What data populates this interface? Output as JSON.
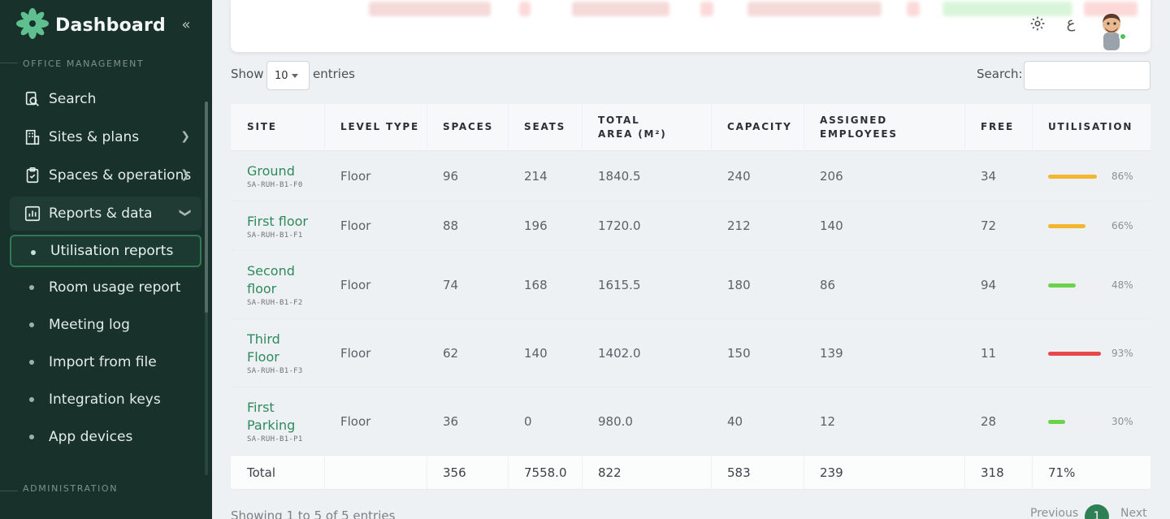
{
  "brand": {
    "title": "Dashboard",
    "collapse_icon": "double-chevron-left-icon"
  },
  "sidebar": {
    "section_office": "OFFICE MANAGEMENT",
    "section_admin": "ADMINISTRATION",
    "items": [
      {
        "label": "Search",
        "icon": "search-icon"
      },
      {
        "label": "Sites & plans",
        "icon": "building-icon"
      },
      {
        "label": "Spaces & operations",
        "icon": "clipboard-check-icon"
      },
      {
        "label": "Reports & data",
        "icon": "chart-icon"
      }
    ],
    "sub_items": [
      {
        "label": "Utilisation reports"
      },
      {
        "label": "Room usage report"
      },
      {
        "label": "Meeting log"
      },
      {
        "label": "Import from file"
      },
      {
        "label": "Integration keys"
      },
      {
        "label": "App devices"
      }
    ]
  },
  "topbar": {
    "settings_icon": "gear-icon",
    "language_glyph": "ع",
    "avatar": "user-avatar"
  },
  "controls": {
    "show_label": "Show",
    "page_length": "10",
    "entries_label": "entries",
    "search_label": "Search:",
    "search_value": ""
  },
  "table": {
    "headers": [
      "SITE",
      "LEVEL TYPE",
      "SPACES",
      "SEATS",
      "TOTAL AREA (M²)",
      "CAPACITY",
      "ASSIGNED EMPLOYEES",
      "FREE",
      "UTILISATION"
    ],
    "rows": [
      {
        "site_lines": [
          "Ground"
        ],
        "code": "SA-RUH-B1-F0",
        "level_type": "Floor",
        "spaces": "96",
        "seats": "214",
        "area": "1840.5",
        "capacity": "240",
        "assigned": "206",
        "free": "34",
        "util": "86%",
        "util_value": 0.86,
        "util_color": "#f2b630"
      },
      {
        "site_lines": [
          "First floor"
        ],
        "code": "SA-RUH-B1-F1",
        "level_type": "Floor",
        "spaces": "88",
        "seats": "196",
        "area": "1720.0",
        "capacity": "212",
        "assigned": "140",
        "free": "72",
        "util": "66%",
        "util_value": 0.66,
        "util_color": "#f2b630"
      },
      {
        "site_lines": [
          "Second",
          "floor"
        ],
        "code": "SA-RUH-B1-F2",
        "level_type": "Floor",
        "spaces": "74",
        "seats": "168",
        "area": "1615.5",
        "capacity": "180",
        "assigned": "86",
        "free": "94",
        "util": "48%",
        "util_value": 0.48,
        "util_color": "#6cd24a"
      },
      {
        "site_lines": [
          "Third",
          "Floor"
        ],
        "code": "SA-RUH-B1-F3",
        "level_type": "Floor",
        "spaces": "62",
        "seats": "140",
        "area": "1402.0",
        "capacity": "150",
        "assigned": "139",
        "free": "11",
        "util": "93%",
        "util_value": 0.93,
        "util_color": "#e8474c"
      },
      {
        "site_lines": [
          "First",
          "Parking"
        ],
        "code": "SA-RUH-B1-P1",
        "level_type": "Floor",
        "spaces": "36",
        "seats": "0",
        "area": "980.0",
        "capacity": "40",
        "assigned": "12",
        "free": "28",
        "util": "30%",
        "util_value": 0.3,
        "util_color": "#6cd24a"
      }
    ],
    "total": {
      "label": "Total",
      "spaces": "356",
      "seats": "7558.0",
      "area": "822",
      "capacity": "583",
      "assigned": "239",
      "free": "318",
      "util": "71%"
    }
  },
  "footer": {
    "info": "Showing 1 to 5 of 5 entries",
    "previous": "Previous",
    "page": "1",
    "next": "Next"
  }
}
